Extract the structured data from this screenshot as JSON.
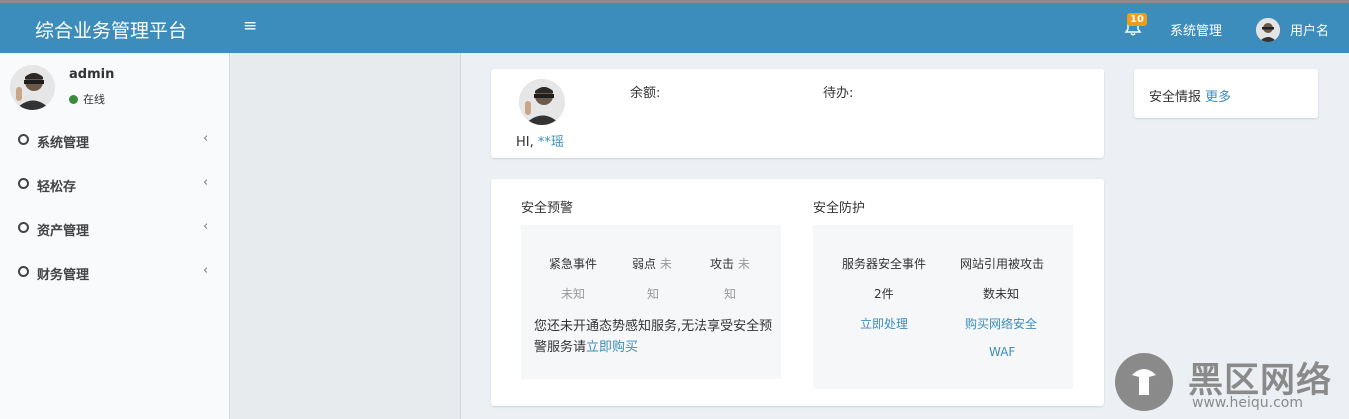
{
  "app": {
    "title": "综合业务管理平台",
    "menu_toggle_glyph": "≡"
  },
  "topbar": {
    "notifications": {
      "icon": "bell-icon",
      "count": "10"
    },
    "system_link": "系统管理",
    "user_name": "用户名"
  },
  "sidebar": {
    "user": {
      "name": "admin",
      "status": "在线",
      "status_color": "#3a8a3a"
    },
    "items": [
      {
        "label": "系统管理",
        "icon": "circle-icon",
        "arrow": "‹"
      },
      {
        "label": "轻松存",
        "icon": "circle-icon",
        "arrow": "‹"
      },
      {
        "label": "资产管理",
        "icon": "circle-icon",
        "arrow": "‹"
      },
      {
        "label": "财务管理",
        "icon": "circle-icon",
        "arrow": "‹"
      }
    ]
  },
  "profile": {
    "greeting": "HI,",
    "username": "**瑶",
    "balance_label": "余额:",
    "todo_label": "待办:"
  },
  "security": {
    "warning": {
      "title": "安全预警",
      "stats": [
        {
          "label": "紧急事件",
          "value": "未知"
        },
        {
          "label": "弱点",
          "value_inline": "未",
          "value": "知"
        },
        {
          "label": "攻击",
          "value_inline": "未",
          "value": "知"
        }
      ],
      "notice_text": "您还未开通态势感知服务,无法享受安全预警服务请",
      "notice_link": "立即购买"
    },
    "protection": {
      "title": "安全防护",
      "server_events_label": "服务器安全事件",
      "server_events_value": "2件",
      "server_action": "立即处理",
      "website_label": "网站引用被攻击",
      "website_value": "数未知",
      "website_action_line1": "购买网络安全",
      "website_action_line2": "WAF"
    }
  },
  "intel": {
    "title": "安全情报",
    "more_link": "更多"
  },
  "watermark": {
    "text": "黑区网络",
    "url": "www.heiqu.com"
  },
  "colors": {
    "accent": "#3c8dbc",
    "link": "#3c8dbc",
    "badge": "#f39c12"
  }
}
